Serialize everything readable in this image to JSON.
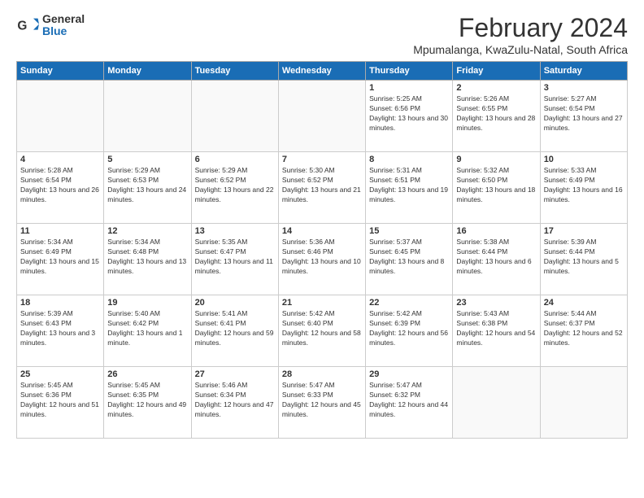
{
  "header": {
    "logo_general": "General",
    "logo_blue": "Blue",
    "month_title": "February 2024",
    "subtitle": "Mpumalanga, KwaZulu-Natal, South Africa"
  },
  "weekdays": [
    "Sunday",
    "Monday",
    "Tuesday",
    "Wednesday",
    "Thursday",
    "Friday",
    "Saturday"
  ],
  "weeks": [
    [
      {
        "day": "",
        "empty": true
      },
      {
        "day": "",
        "empty": true
      },
      {
        "day": "",
        "empty": true
      },
      {
        "day": "",
        "empty": true
      },
      {
        "day": "1",
        "sunrise": "5:25 AM",
        "sunset": "6:56 PM",
        "daylight": "13 hours and 30 minutes."
      },
      {
        "day": "2",
        "sunrise": "5:26 AM",
        "sunset": "6:55 PM",
        "daylight": "13 hours and 28 minutes."
      },
      {
        "day": "3",
        "sunrise": "5:27 AM",
        "sunset": "6:54 PM",
        "daylight": "13 hours and 27 minutes."
      }
    ],
    [
      {
        "day": "4",
        "sunrise": "5:28 AM",
        "sunset": "6:54 PM",
        "daylight": "13 hours and 26 minutes."
      },
      {
        "day": "5",
        "sunrise": "5:29 AM",
        "sunset": "6:53 PM",
        "daylight": "13 hours and 24 minutes."
      },
      {
        "day": "6",
        "sunrise": "5:29 AM",
        "sunset": "6:52 PM",
        "daylight": "13 hours and 22 minutes."
      },
      {
        "day": "7",
        "sunrise": "5:30 AM",
        "sunset": "6:52 PM",
        "daylight": "13 hours and 21 minutes."
      },
      {
        "day": "8",
        "sunrise": "5:31 AM",
        "sunset": "6:51 PM",
        "daylight": "13 hours and 19 minutes."
      },
      {
        "day": "9",
        "sunrise": "5:32 AM",
        "sunset": "6:50 PM",
        "daylight": "13 hours and 18 minutes."
      },
      {
        "day": "10",
        "sunrise": "5:33 AM",
        "sunset": "6:49 PM",
        "daylight": "13 hours and 16 minutes."
      }
    ],
    [
      {
        "day": "11",
        "sunrise": "5:34 AM",
        "sunset": "6:49 PM",
        "daylight": "13 hours and 15 minutes."
      },
      {
        "day": "12",
        "sunrise": "5:34 AM",
        "sunset": "6:48 PM",
        "daylight": "13 hours and 13 minutes."
      },
      {
        "day": "13",
        "sunrise": "5:35 AM",
        "sunset": "6:47 PM",
        "daylight": "13 hours and 11 minutes."
      },
      {
        "day": "14",
        "sunrise": "5:36 AM",
        "sunset": "6:46 PM",
        "daylight": "13 hours and 10 minutes."
      },
      {
        "day": "15",
        "sunrise": "5:37 AM",
        "sunset": "6:45 PM",
        "daylight": "13 hours and 8 minutes."
      },
      {
        "day": "16",
        "sunrise": "5:38 AM",
        "sunset": "6:44 PM",
        "daylight": "13 hours and 6 minutes."
      },
      {
        "day": "17",
        "sunrise": "5:39 AM",
        "sunset": "6:44 PM",
        "daylight": "13 hours and 5 minutes."
      }
    ],
    [
      {
        "day": "18",
        "sunrise": "5:39 AM",
        "sunset": "6:43 PM",
        "daylight": "13 hours and 3 minutes."
      },
      {
        "day": "19",
        "sunrise": "5:40 AM",
        "sunset": "6:42 PM",
        "daylight": "13 hours and 1 minute."
      },
      {
        "day": "20",
        "sunrise": "5:41 AM",
        "sunset": "6:41 PM",
        "daylight": "12 hours and 59 minutes."
      },
      {
        "day": "21",
        "sunrise": "5:42 AM",
        "sunset": "6:40 PM",
        "daylight": "12 hours and 58 minutes."
      },
      {
        "day": "22",
        "sunrise": "5:42 AM",
        "sunset": "6:39 PM",
        "daylight": "12 hours and 56 minutes."
      },
      {
        "day": "23",
        "sunrise": "5:43 AM",
        "sunset": "6:38 PM",
        "daylight": "12 hours and 54 minutes."
      },
      {
        "day": "24",
        "sunrise": "5:44 AM",
        "sunset": "6:37 PM",
        "daylight": "12 hours and 52 minutes."
      }
    ],
    [
      {
        "day": "25",
        "sunrise": "5:45 AM",
        "sunset": "6:36 PM",
        "daylight": "12 hours and 51 minutes."
      },
      {
        "day": "26",
        "sunrise": "5:45 AM",
        "sunset": "6:35 PM",
        "daylight": "12 hours and 49 minutes."
      },
      {
        "day": "27",
        "sunrise": "5:46 AM",
        "sunset": "6:34 PM",
        "daylight": "12 hours and 47 minutes."
      },
      {
        "day": "28",
        "sunrise": "5:47 AM",
        "sunset": "6:33 PM",
        "daylight": "12 hours and 45 minutes."
      },
      {
        "day": "29",
        "sunrise": "5:47 AM",
        "sunset": "6:32 PM",
        "daylight": "12 hours and 44 minutes."
      },
      {
        "day": "",
        "empty": true
      },
      {
        "day": "",
        "empty": true
      }
    ]
  ]
}
